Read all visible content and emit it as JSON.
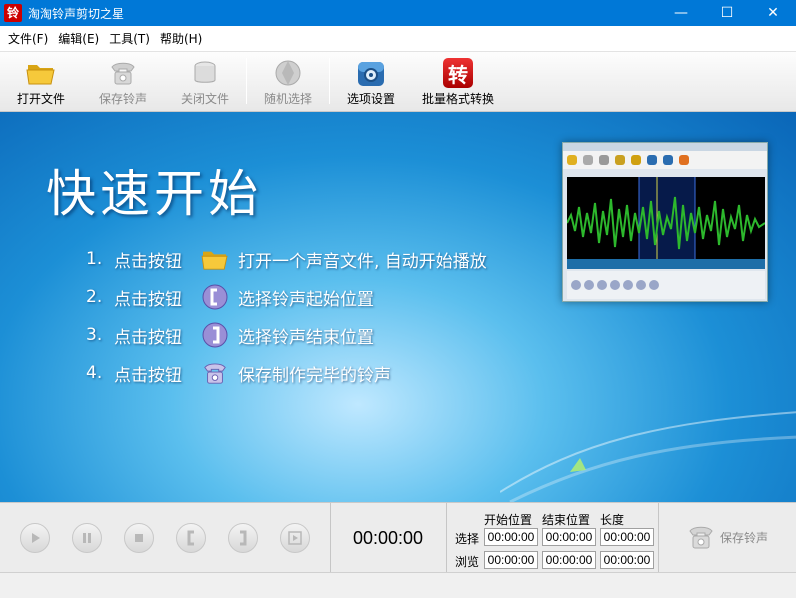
{
  "window": {
    "app_icon_char": "铃",
    "title": "淘淘铃声剪切之星",
    "controls": [
      "—",
      "☐",
      "✕"
    ]
  },
  "menu": [
    "文件(F)",
    "编辑(E)",
    "工具(T)",
    "帮助(H)"
  ],
  "toolbar": {
    "open": "打开文件",
    "save": "保存铃声",
    "close": "关闭文件",
    "random": "随机选择",
    "options": "选项设置",
    "batch": "批量格式转换",
    "batch_icon_char": "转"
  },
  "quickstart": {
    "title": "快速开始",
    "steps": [
      {
        "num": "1.",
        "action": "点击按钮",
        "icon": "folder-icon",
        "text": "打开一个声音文件, 自动开始播放"
      },
      {
        "num": "2.",
        "action": "点击按钮",
        "icon": "start-bracket-icon",
        "text": "选择铃声起始位置"
      },
      {
        "num": "3.",
        "action": "点击按钮",
        "icon": "end-bracket-icon",
        "text": "选择铃声结束位置"
      },
      {
        "num": "4.",
        "action": "点击按钮",
        "icon": "phone-icon",
        "text": "保存制作完毕的铃声"
      }
    ]
  },
  "panel": {
    "current_time": "00:00:00",
    "headers": {
      "start": "开始位置",
      "end": "结束位置",
      "length": "长度"
    },
    "rows": {
      "select": {
        "label": "选择",
        "start": "00:00:00",
        "end": "00:00:00",
        "length": "00:00:00"
      },
      "browse": {
        "label": "浏览",
        "start": "00:00:00",
        "end": "00:00:00",
        "length": "00:00:00"
      }
    },
    "save_label": "保存铃声"
  },
  "colors": {
    "titlebar": "#0078d7",
    "main_blue": "#1c8fd6",
    "waveform_green": "#2db82d"
  }
}
